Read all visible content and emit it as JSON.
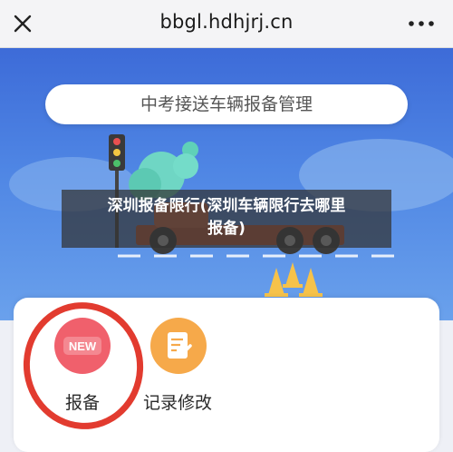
{
  "browser": {
    "url": "bbgl.hdhjrj.cn"
  },
  "hero": {
    "title": "中考接送车辆报备管理"
  },
  "caption": {
    "line1": "深圳报备限行(深圳车辆限行去哪里",
    "line2": "报备)"
  },
  "actions": [
    {
      "label": "报备",
      "badge": "NEW",
      "icon": "new-badge-icon"
    },
    {
      "label": "记录修改",
      "icon": "document-edit-icon"
    }
  ],
  "colors": {
    "hero_top": "#3d6bd8",
    "highlight_circle": "#e23b2f",
    "report_icon": "#f0606c",
    "edit_icon": "#f6a94a"
  }
}
